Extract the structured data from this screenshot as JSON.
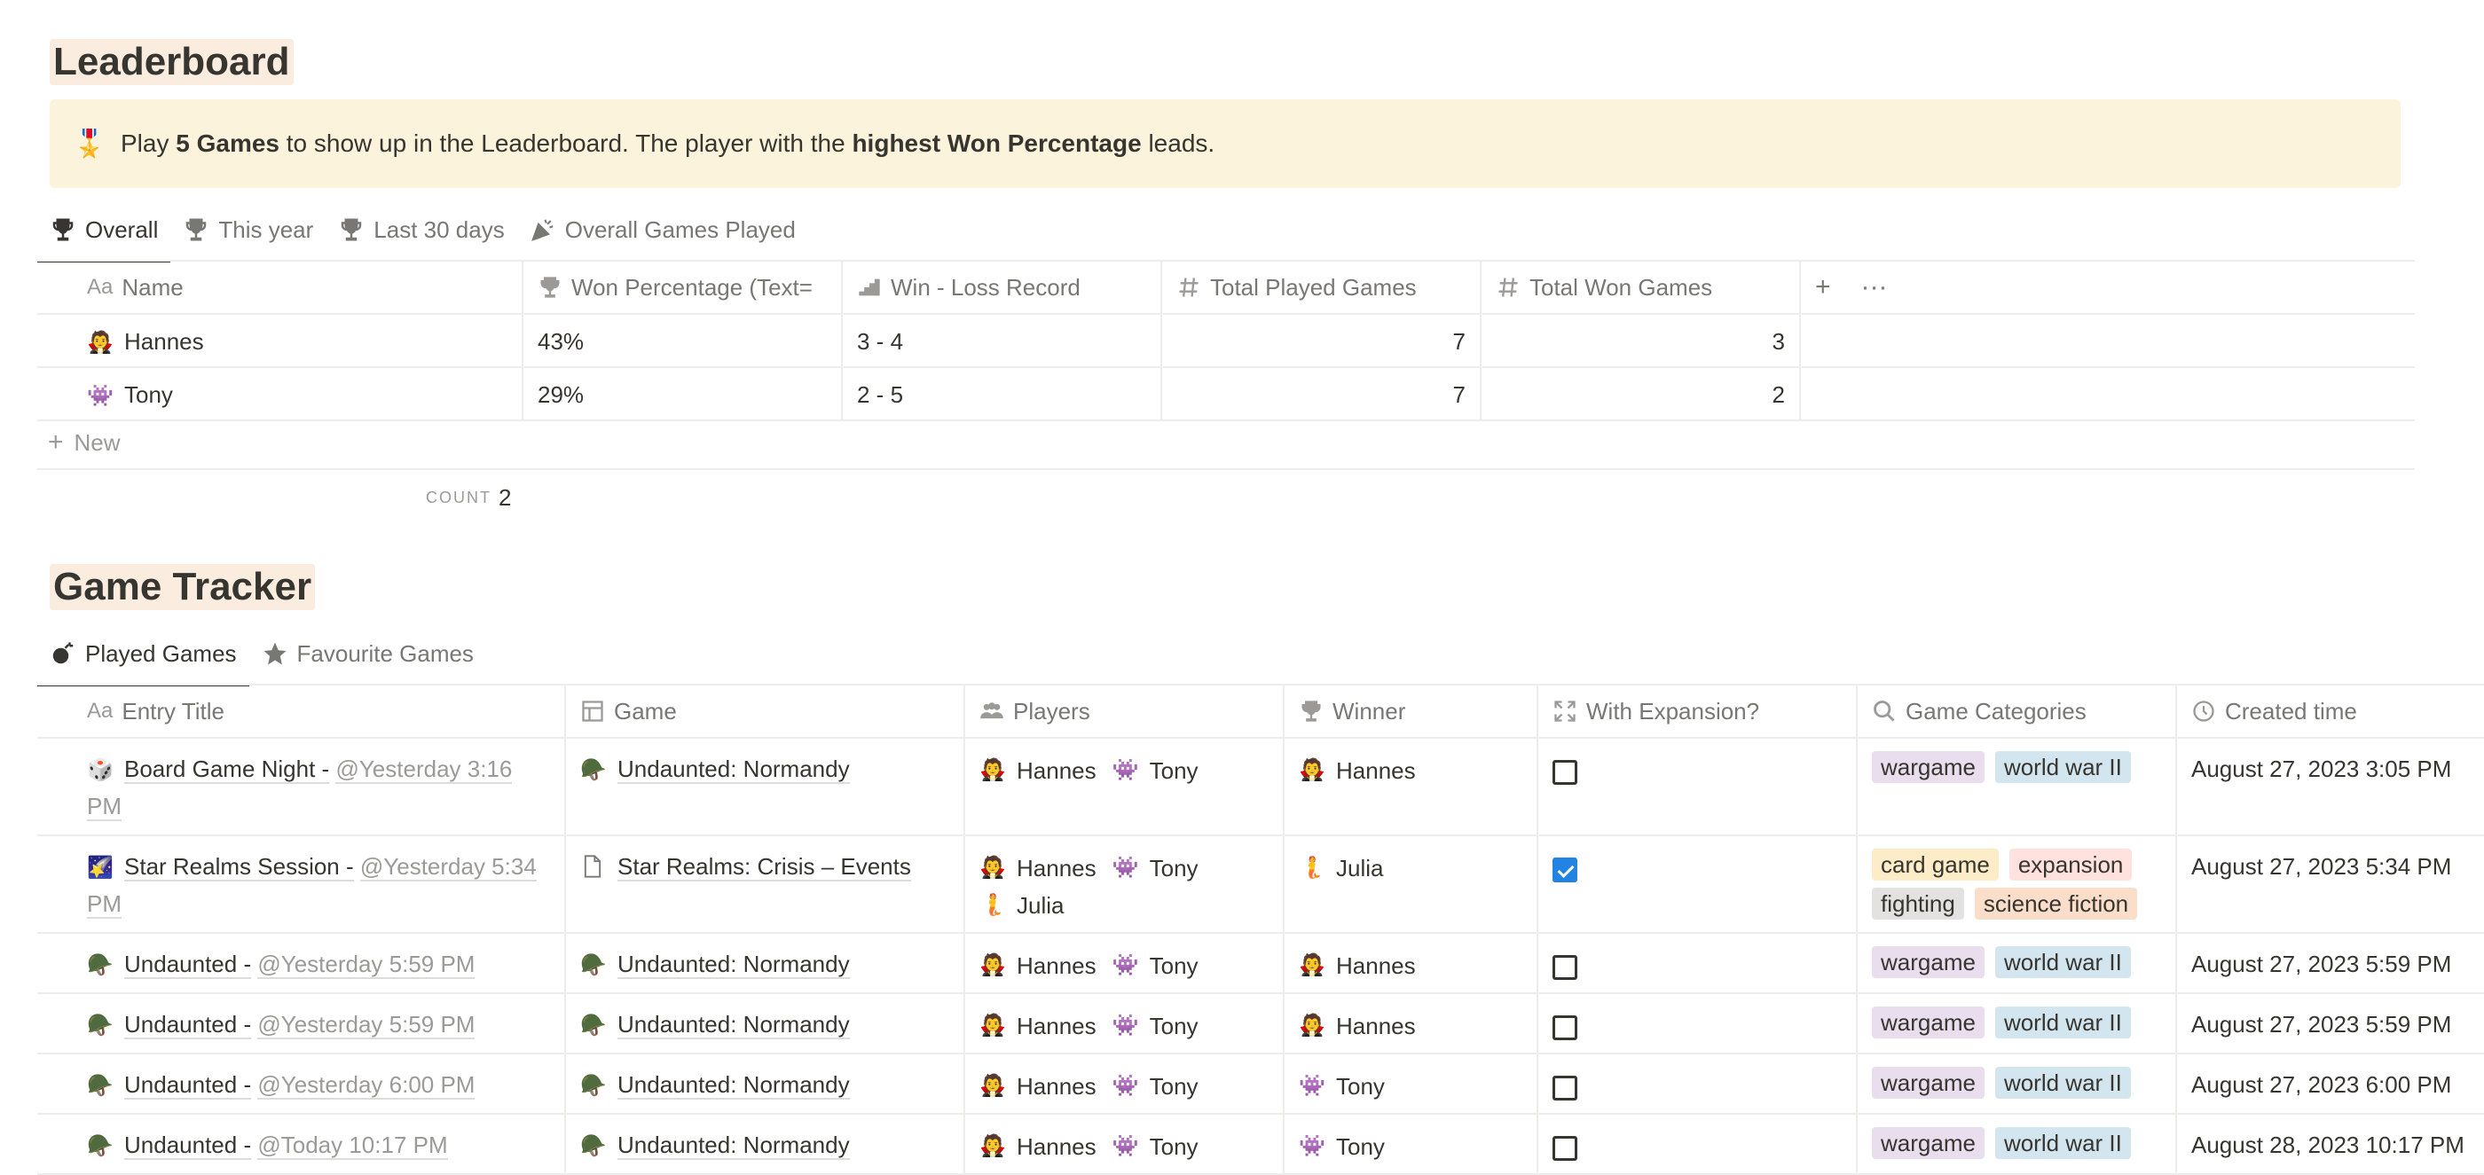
{
  "leaderboard": {
    "title": "Leaderboard",
    "callout": {
      "emoji": "🎖️",
      "t1": "Play ",
      "b1": "5 Games",
      "t2": " to show up in the Leaderboard. The player with the ",
      "b2": "highest Won Percentage",
      "t3": " leads."
    },
    "tabs": [
      "Overall",
      "This year",
      "Last 30 days",
      "Overall Games Played"
    ],
    "columns": [
      "Name",
      "Won Percentage (Text=",
      "Win - Loss Record",
      "Total Played Games",
      "Total Won Games"
    ],
    "rows": [
      {
        "emoji": "🧛",
        "name": "Hannes",
        "pct": "43%",
        "record": "3 - 4",
        "played": "7",
        "won": "3"
      },
      {
        "emoji": "👾",
        "name": "Tony",
        "pct": "29%",
        "record": "2 - 5",
        "played": "7",
        "won": "2"
      }
    ],
    "new_label": "New",
    "count_label": "COUNT",
    "count_value": "2"
  },
  "tracker": {
    "title": "Game Tracker",
    "tabs": [
      "Played Games",
      "Favourite Games"
    ],
    "columns": [
      "Entry Title",
      "Game",
      "Players",
      "Winner",
      "With Expansion?",
      "Game Categories",
      "Created time"
    ],
    "rows": [
      {
        "emoji": "🎲",
        "title": "Board Game Night -",
        "mention": "@Yesterday 3:16 PM",
        "game_emoji": "🪖",
        "game": "Undaunted: Normandy",
        "players": [
          "Hannes",
          "Tony"
        ],
        "winner": "Hannes",
        "expansion": false,
        "tags": [
          "wargame",
          "world war II"
        ],
        "created": "August 27, 2023 3:05 PM"
      },
      {
        "emoji": "🌠",
        "title": "Star Realms Session -",
        "mention": "@Yesterday 5:34 PM",
        "game_emoji": "📄",
        "game": "Star Realms: Crisis – Events",
        "players": [
          "Hannes",
          "Tony",
          "Julia"
        ],
        "winner": "Julia",
        "expansion": true,
        "tags": [
          "card game",
          "expansion",
          "fighting",
          "science fiction"
        ],
        "created": "August 27, 2023 5:34 PM"
      },
      {
        "emoji": "🪖",
        "title": "Undaunted -",
        "mention": "@Yesterday 5:59 PM",
        "game_emoji": "🪖",
        "game": "Undaunted: Normandy",
        "players": [
          "Hannes",
          "Tony"
        ],
        "winner": "Hannes",
        "expansion": false,
        "tags": [
          "wargame",
          "world war II"
        ],
        "created": "August 27, 2023 5:59 PM"
      },
      {
        "emoji": "🪖",
        "title": "Undaunted -",
        "mention": "@Yesterday 5:59 PM",
        "game_emoji": "🪖",
        "game": "Undaunted: Normandy",
        "players": [
          "Hannes",
          "Tony"
        ],
        "winner": "Hannes",
        "expansion": false,
        "tags": [
          "wargame",
          "world war II"
        ],
        "created": "August 27, 2023 5:59 PM"
      },
      {
        "emoji": "🪖",
        "title": "Undaunted -",
        "mention": "@Yesterday 6:00 PM",
        "game_emoji": "🪖",
        "game": "Undaunted: Normandy",
        "players": [
          "Hannes",
          "Tony"
        ],
        "winner": "Tony",
        "expansion": false,
        "tags": [
          "wargame",
          "world war II"
        ],
        "created": "August 27, 2023 6:00 PM"
      },
      {
        "emoji": "🪖",
        "title": "Undaunted -",
        "mention": "@Today 10:17 PM",
        "game_emoji": "🪖",
        "game": "Undaunted: Normandy",
        "players": [
          "Hannes",
          "Tony"
        ],
        "winner": "Tony",
        "expansion": false,
        "tags": [
          "wargame",
          "world war II"
        ],
        "created": "August 28, 2023 10:17 PM"
      }
    ]
  },
  "player_emoji": {
    "Hannes": "🧛",
    "Tony": "👾",
    "Julia": "🧜"
  },
  "tag_colors": {
    "wargame": "#e8deee",
    "world war II": "#d3e5ef",
    "card game": "#fdecc8",
    "expansion": "#ffe2dd",
    "fighting": "#e3e2e0",
    "science fiction": "#fadec9"
  }
}
